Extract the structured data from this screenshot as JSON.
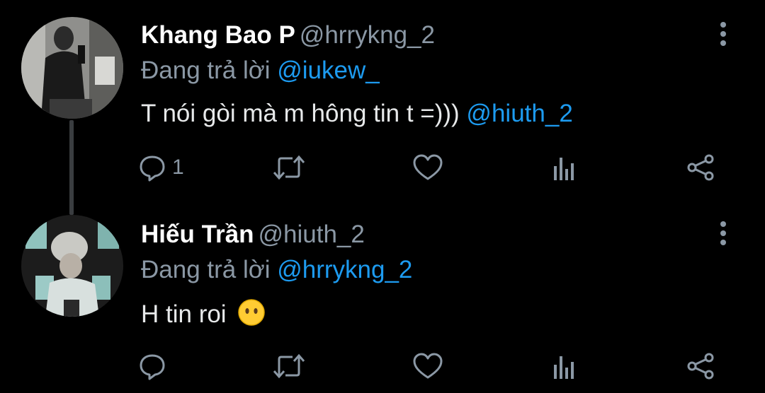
{
  "colors": {
    "background": "#000000",
    "text": "#e7e9ea",
    "secondary": "#8b98a5",
    "mention": "#1d9bf0",
    "thread_line": "#3a3d40"
  },
  "tweets": [
    {
      "display_name": "Khang Bao P",
      "handle": "@hrrykng_2",
      "replying_prefix": "Đang trả lời",
      "replying_to": "@iukew_",
      "text": "T nói gòi mà m hông tin t =)))",
      "text_mention": "@hiuth_2",
      "reply_count": "1",
      "avatar_icon": "profile-photo",
      "emoji": ""
    },
    {
      "display_name": "Hiếu Trần",
      "handle": "@hiuth_2",
      "replying_prefix": "Đang trả lời",
      "replying_to": "@hrrykng_2",
      "text": "H tin roi",
      "text_mention": "",
      "reply_count": "",
      "avatar_icon": "profile-photo",
      "emoji": "face-without-mouth"
    }
  ],
  "action_icons": [
    "reply-icon",
    "retweet-icon",
    "like-icon",
    "analytics-icon",
    "share-icon"
  ],
  "menu_icon": "more-vertical-icon"
}
